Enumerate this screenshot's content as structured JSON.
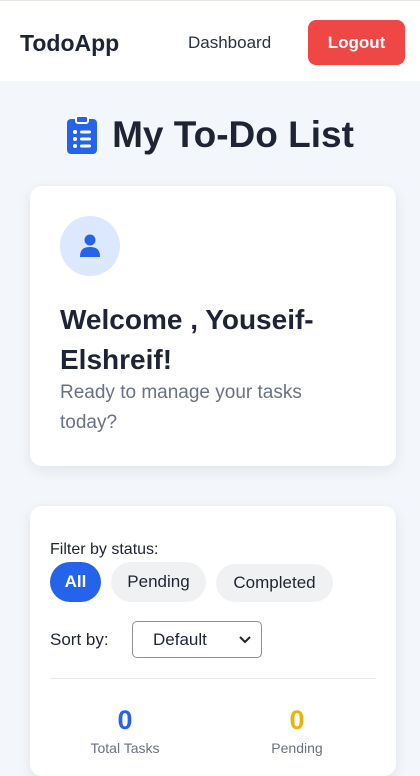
{
  "navbar": {
    "brand": "TodoApp",
    "dashboard_link": "Dashboard",
    "logout_label": "Logout"
  },
  "page": {
    "title": "My To-Do List",
    "title_icon": "clipboard-list-icon"
  },
  "welcome": {
    "avatar_icon": "user-icon",
    "greeting": "Welcome , Youseif-Elshreif!",
    "subtitle": "Ready to manage your tasks today?"
  },
  "filters": {
    "label": "Filter by status:",
    "options": [
      "All",
      "Pending",
      "Completed"
    ],
    "active": "All",
    "sort_label": "Sort by:",
    "sort_value": "Default"
  },
  "stats": {
    "total": {
      "value": "0",
      "label": "Total Tasks",
      "color": "#2563eb"
    },
    "pending": {
      "value": "0",
      "label": "Pending",
      "color": "#eab308"
    }
  },
  "colors": {
    "accent": "#2563eb",
    "logout": "#ef4646",
    "background": "#f3f6fa"
  }
}
